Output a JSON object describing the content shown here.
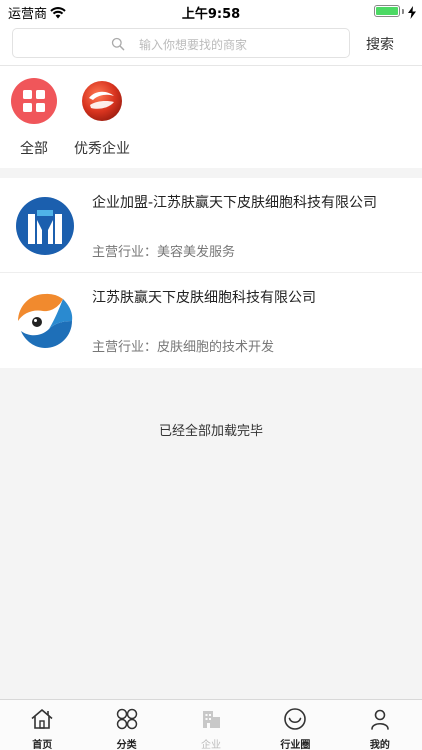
{
  "status_bar": {
    "carrier": "运营商",
    "time": "上午9:58"
  },
  "search": {
    "placeholder": "输入你想要找的商家",
    "button_label": "搜索"
  },
  "categories": [
    {
      "label": "全部",
      "icon": "grid-icon",
      "color": "#f0565a"
    },
    {
      "label": "优秀企业",
      "icon": "company-logo-icon",
      "color": "#d9341f"
    }
  ],
  "companies": [
    {
      "title": "企业加盟-江苏肤赢天下皮肤细胞科技有限公司",
      "desc": "主营行业：美容美发服务",
      "logo": "blue-building-logo"
    },
    {
      "title": "江苏肤赢天下皮肤细胞科技有限公司",
      "desc": "主营行业：皮肤细胞的技术开发",
      "logo": "orange-blue-swirl-logo"
    }
  ],
  "footer": {
    "loaded_text": "已经全部加载完毕"
  },
  "tabs": [
    {
      "label": "首页",
      "icon": "home-icon"
    },
    {
      "label": "分类",
      "icon": "category-icon"
    },
    {
      "label": "企业",
      "icon": "building-icon",
      "active": true
    },
    {
      "label": "行业圈",
      "icon": "smile-icon"
    },
    {
      "label": "我的",
      "icon": "user-icon"
    }
  ]
}
